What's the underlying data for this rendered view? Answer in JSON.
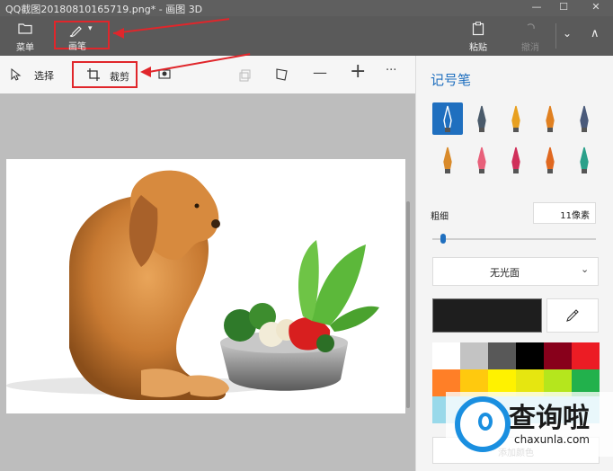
{
  "window": {
    "title": "QQ截图20180810165719.png* - 画图 3D",
    "minimize": "—",
    "maximize": "☐",
    "close": "✕"
  },
  "ribbon": {
    "menu_label": "菜单",
    "brush_label": "画笔",
    "paste_label": "粘贴",
    "undo_label": "撤消",
    "more": "⌄",
    "collapse": "∧"
  },
  "toolbar": {
    "select_label": "选择",
    "crop_label": "裁剪",
    "minus": "—",
    "plus": "+",
    "more": "···"
  },
  "panel": {
    "title": "记号笔",
    "thickness_label": "粗细",
    "thickness_value": "11像素",
    "thickness_level": 0.05,
    "finish_value": "无光面",
    "current_color": "#1e1e1e",
    "brushes": [
      {
        "name": "marker-icon",
        "color": "#2b4f9a",
        "bg": "#1f6fbf"
      },
      {
        "name": "calligraphy-pen-icon",
        "color": "#4a5a6a"
      },
      {
        "name": "oil-brush-icon",
        "color": "#e8a020"
      },
      {
        "name": "watercolor-icon",
        "color": "#e08020"
      },
      {
        "name": "pixel-pen-icon",
        "color": "#4a5a7a"
      },
      {
        "name": "pencil-icon",
        "color": "#d98a2a"
      },
      {
        "name": "eraser-icon",
        "color": "#e8607a"
      },
      {
        "name": "crayon-icon",
        "color": "#d0305a"
      },
      {
        "name": "spray-can-icon",
        "color": "#e06820"
      },
      {
        "name": "fill-bucket-icon",
        "color": "#2aa08a"
      }
    ],
    "palette": [
      "#ffffff",
      "#c3c3c3",
      "#585858",
      "#000000",
      "#88001b",
      "#ec1c24",
      "#ff7f27",
      "#ffc90e",
      "#fff200",
      "#e6e610",
      "#b5e61d",
      "#22b14c",
      "#99d9ea",
      "#99d9ea",
      "#99d9ea",
      "#99d9ea",
      "#99d9ea",
      "#99d9ea"
    ],
    "add_color_label": "添加颜色"
  },
  "watermark": {
    "brand_text": "查询啦",
    "brand_url": "chaxunla.com"
  }
}
